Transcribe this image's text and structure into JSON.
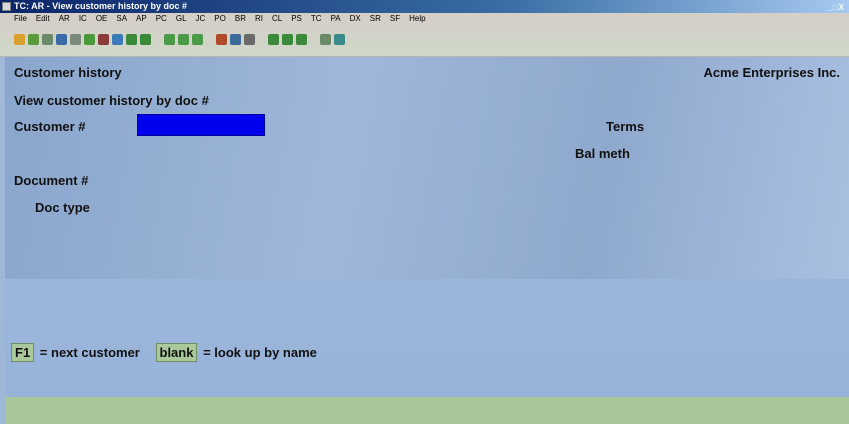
{
  "window": {
    "title": "TC: AR - View customer history by doc #",
    "controls": "_□X"
  },
  "menubar": {
    "items": [
      "File",
      "Edit",
      "AR",
      "IC",
      "OE",
      "SA",
      "AP",
      "PC",
      "GL",
      "JC",
      "PO",
      "BR",
      "RI",
      "CL",
      "PS",
      "TC",
      "PA",
      "DX",
      "SR",
      "SF",
      "Help"
    ]
  },
  "toolbar": {
    "icons": [
      {
        "name": "new-icon",
        "color": "#d9a030"
      },
      {
        "name": "copy-icon",
        "color": "#5a9a3a"
      },
      {
        "name": "settings-icon",
        "color": "#6a8a6a"
      },
      {
        "name": "globe-icon",
        "color": "#3a6aa8"
      },
      {
        "name": "edit-icon",
        "color": "#7a8a7a"
      },
      {
        "name": "check-icon",
        "color": "#4a9a3a"
      },
      {
        "name": "delete-icon",
        "color": "#8a3a3a"
      },
      {
        "name": "undo-icon",
        "color": "#3a7ab8"
      },
      {
        "name": "up-icon",
        "color": "#3a8a3a"
      },
      {
        "name": "down-icon",
        "color": "#3a8a3a"
      },
      {
        "name": "record-1-icon",
        "color": "#4a9a4a"
      },
      {
        "name": "record-2-icon",
        "color": "#4a9a4a"
      },
      {
        "name": "record-3-icon",
        "color": "#4a9a4a"
      },
      {
        "name": "find-icon",
        "color": "#b04a2a"
      },
      {
        "name": "zoom-icon",
        "color": "#3a6a9a"
      },
      {
        "name": "refresh-icon",
        "color": "#6a6a6a"
      },
      {
        "name": "prev-icon",
        "color": "#3a8a3a"
      },
      {
        "name": "next-icon",
        "color": "#3a8a3a"
      },
      {
        "name": "stop-icon",
        "color": "#3a8a3a"
      },
      {
        "name": "lock-icon",
        "color": "#6a8a6a"
      },
      {
        "name": "help-icon",
        "color": "#3a8a8a"
      }
    ]
  },
  "screen": {
    "heading": "Customer history",
    "company": "Acme Enterprises Inc.",
    "subheading": "View customer history by doc #",
    "customer_label": "Customer #",
    "customer_value": "",
    "terms_label": "Terms",
    "balmeth_label": "Bal meth",
    "document_label": "Document #",
    "doctype_label": "Doc type"
  },
  "keys": {
    "f1": "F1",
    "f1_desc": "= next customer",
    "blank": "blank",
    "blank_desc": "= look up by name"
  },
  "colors": {
    "input_fill": "#0000ee",
    "key_fill": "#a9c99a",
    "status_bar": "#a8c69a",
    "screen_bg": "#9fb8d8"
  }
}
